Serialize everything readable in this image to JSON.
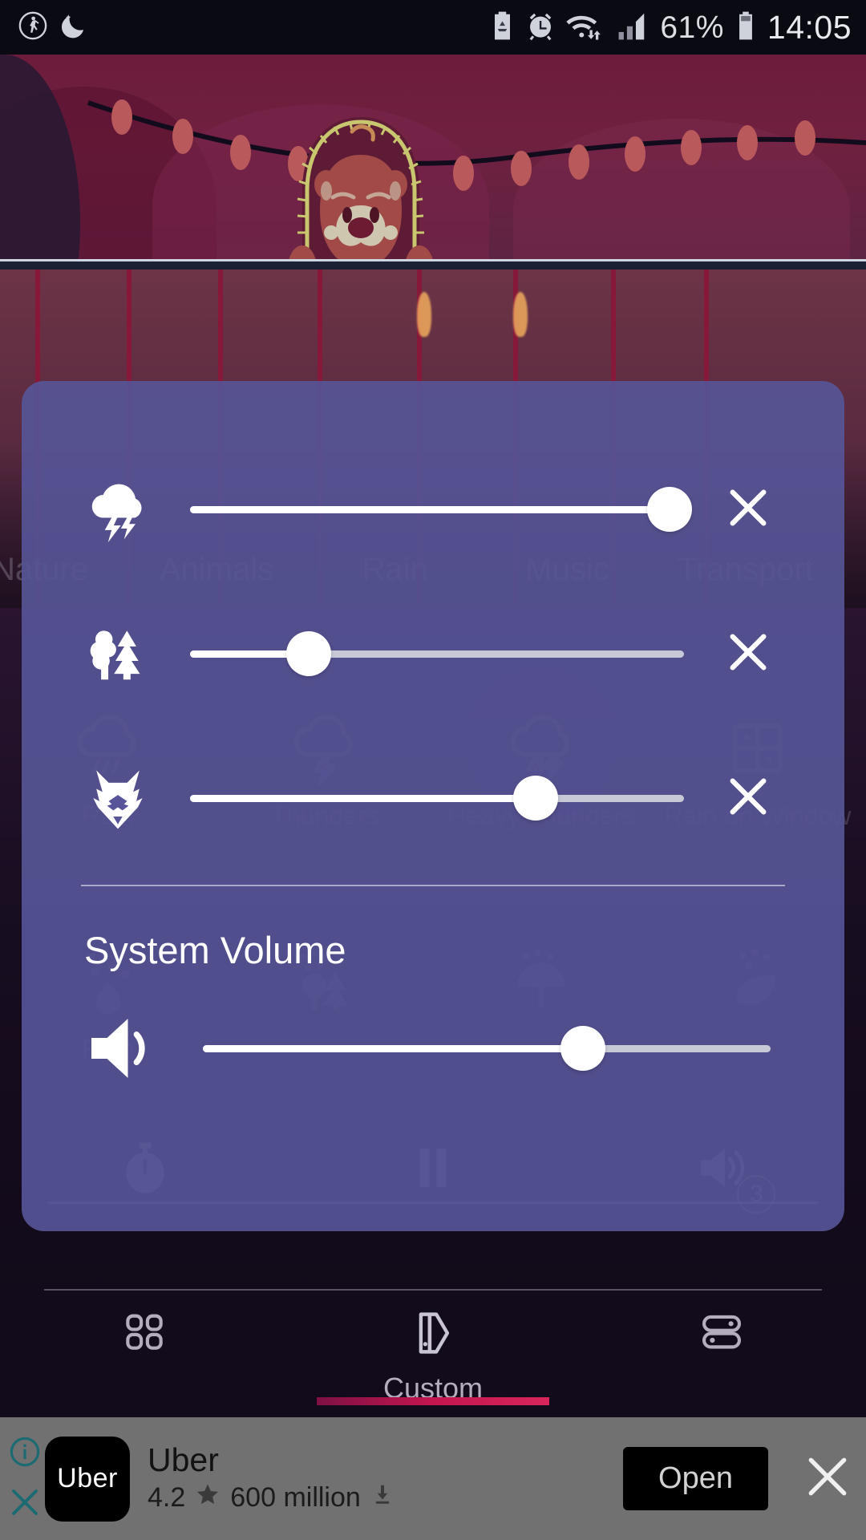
{
  "statusbar": {
    "left_icons": [
      "pedometer-icon",
      "do-not-disturb-moon-icon"
    ],
    "right_icons": [
      "data-saver-icon",
      "alarm-icon",
      "wifi-icon",
      "signal-icon"
    ],
    "battery_percent": "61%",
    "time": "14:05"
  },
  "scene": {
    "character": "bear-mascot",
    "decoration": "string-lights-garland"
  },
  "behind": {
    "category_tabs": [
      {
        "label": "Nature"
      },
      {
        "label": "Animals"
      },
      {
        "label": "Rain"
      },
      {
        "label": "Music"
      },
      {
        "label": "Transport"
      }
    ],
    "sound_tiles": [
      {
        "label": "Rain",
        "icon": "rain-cloud-icon",
        "active": false
      },
      {
        "label": "Thunders",
        "icon": "thunder-cloud-icon",
        "active": false
      },
      {
        "label": "Heavy Thunders",
        "icon": "heavy-thunder-cloud-icon",
        "active": true
      },
      {
        "label": "Rain on Window",
        "icon": "rain-on-window-icon",
        "active": false
      }
    ],
    "sound_tiles_row2": [
      {
        "label": "Rain",
        "icon": "rain-drops-icon"
      },
      {
        "label": "",
        "icon": "forest-trees-icon"
      },
      {
        "label": "",
        "icon": "umbrella-rain-icon"
      },
      {
        "label": "",
        "icon": "leaf-rain-icon"
      }
    ],
    "player": [
      {
        "name": "timer-button",
        "icon": "stopwatch-icon",
        "badge": ""
      },
      {
        "name": "pause-button",
        "icon": "pause-icon",
        "badge": ""
      },
      {
        "name": "volume-mixer-button",
        "icon": "volume-icon",
        "badge": "3"
      }
    ]
  },
  "dialog": {
    "sliders": [
      {
        "icon": "thunder-cloud-icon",
        "label": "Heavy Thunders",
        "value": 97,
        "close_icon": "close-icon"
      },
      {
        "icon": "forest-trees-icon",
        "label": "Forest",
        "value": 24,
        "close_icon": "close-icon"
      },
      {
        "icon": "wolf-head-icon",
        "label": "Wolf",
        "value": 70,
        "close_icon": "close-icon"
      }
    ],
    "system_volume": {
      "title": "System Volume",
      "icon": "speaker-volume-icon",
      "value": 67
    }
  },
  "tabbar": {
    "items": [
      {
        "label": "",
        "icon": "grid-icon",
        "active": false
      },
      {
        "label": "Custom",
        "icon": "custom-mix-icon",
        "active": true
      },
      {
        "label": "",
        "icon": "sliders-icon",
        "active": false
      }
    ],
    "accent": "#c4154f"
  },
  "ad": {
    "icon_text": "Uber",
    "title": "Uber",
    "rating": "4.2",
    "star_icon": "star-icon",
    "installs": "600 million",
    "download_icon": "download-icon",
    "cta_label": "Open",
    "info_icon": "info-icon",
    "dismiss_icon": "close-icon",
    "close_icon": "close-icon"
  }
}
